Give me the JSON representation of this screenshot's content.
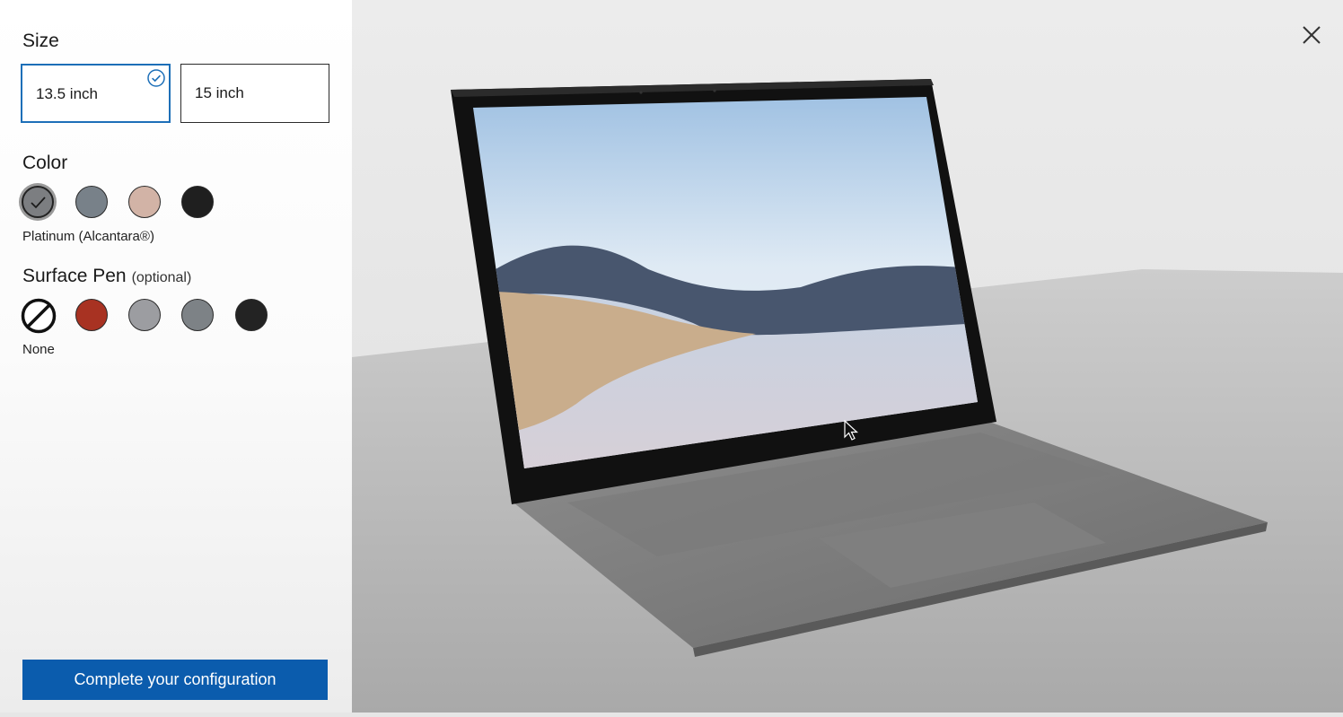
{
  "size": {
    "heading": "Size",
    "options": [
      {
        "label": "13.5 inch",
        "selected": true
      },
      {
        "label": "15 inch",
        "selected": false
      }
    ]
  },
  "color": {
    "heading": "Color",
    "selected_name": "Platinum (Alcantara®)",
    "swatches": [
      "#7c7e81",
      "#788189",
      "#d2b3a6",
      "#1f1f1f"
    ]
  },
  "pen": {
    "heading": "Surface Pen",
    "optional": "(optional)",
    "selected_name": "None",
    "swatches": [
      "none",
      "#a83222",
      "#9c9da1",
      "#7d8286",
      "#232323"
    ]
  },
  "cta_label": "Complete your configuration",
  "icons": {
    "close": "close-icon",
    "check": "check-circle-icon",
    "none": "none-icon",
    "cursor": "mouse-cursor-icon"
  },
  "colors": {
    "accent": "#1d6fb8",
    "cta": "#0b5cad"
  }
}
